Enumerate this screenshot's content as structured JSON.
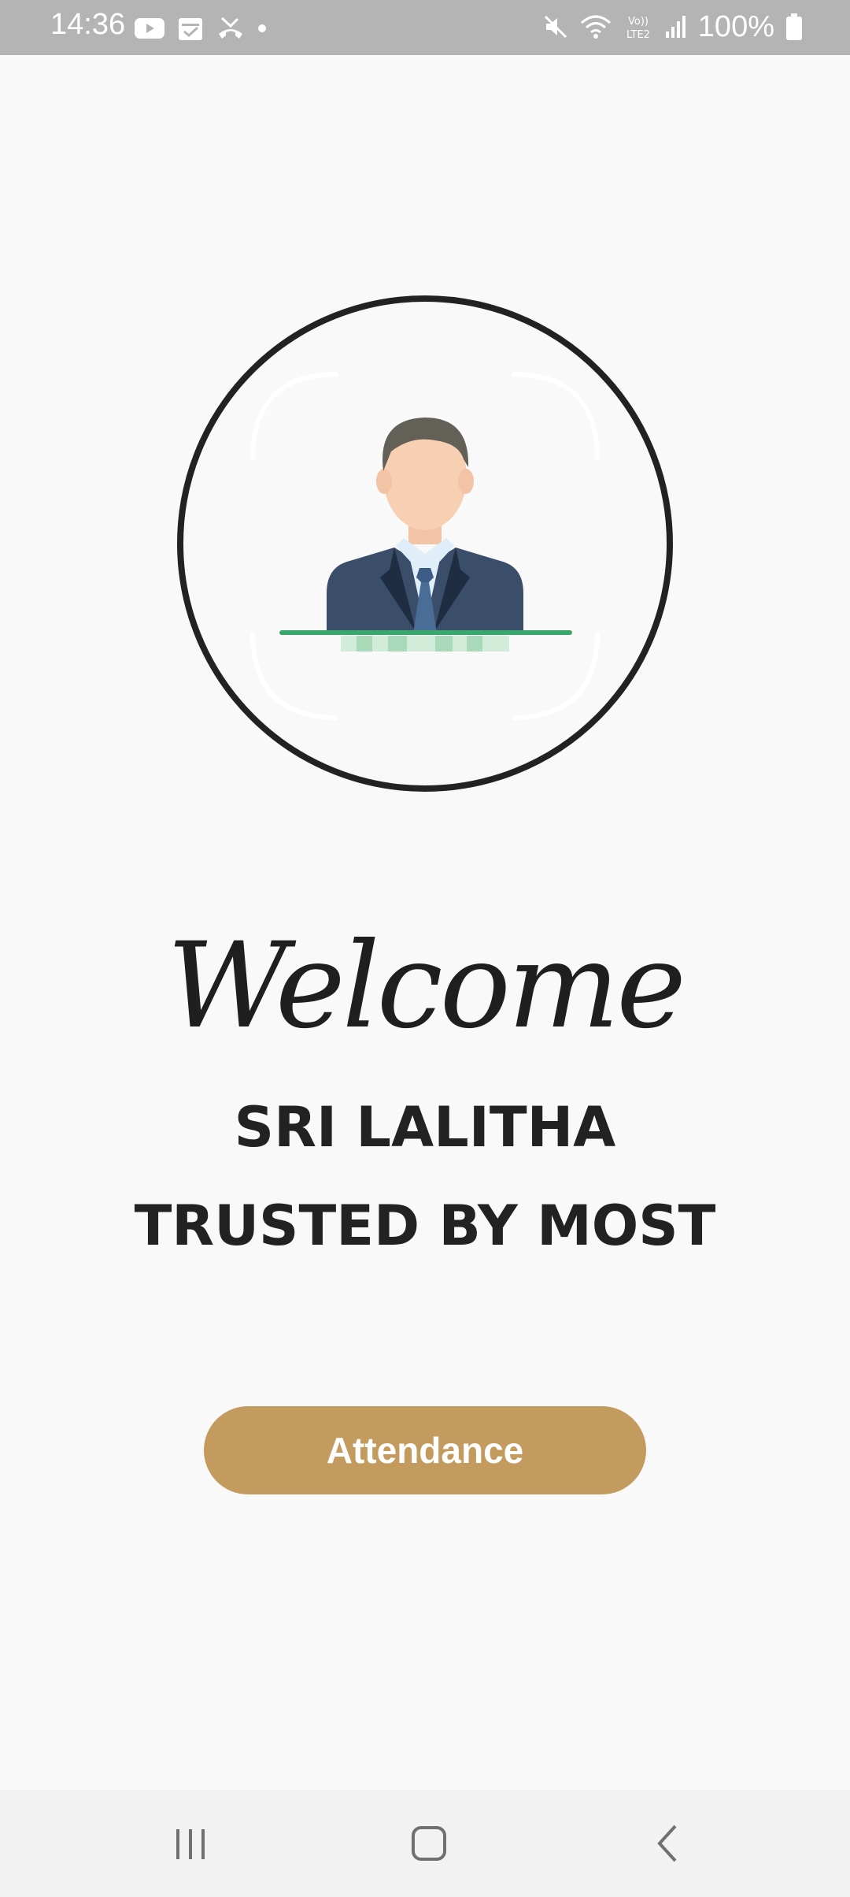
{
  "status_bar": {
    "time": "14:36",
    "battery": "100%",
    "left_icons": [
      "youtube-icon",
      "calendar-icon",
      "missed-call-icon",
      "dot-icon"
    ],
    "right_icons": [
      "mute-icon",
      "wifi-icon",
      "volte-icon",
      "signal-icon",
      "battery-icon"
    ]
  },
  "main": {
    "welcome": "Welcome",
    "company_name": "SRI LALITHA",
    "tagline": "TRUSTED BY MOST",
    "attendance_button": "Attendance"
  },
  "nav_bar": {
    "items": [
      "recent-apps-icon",
      "home-icon",
      "back-icon"
    ]
  },
  "colors": {
    "status_bar_bg": "#b4b4b4",
    "background": "#f9f9f9",
    "button": "#c49b5e",
    "scan_line": "#3aa76d",
    "text": "#222222"
  }
}
